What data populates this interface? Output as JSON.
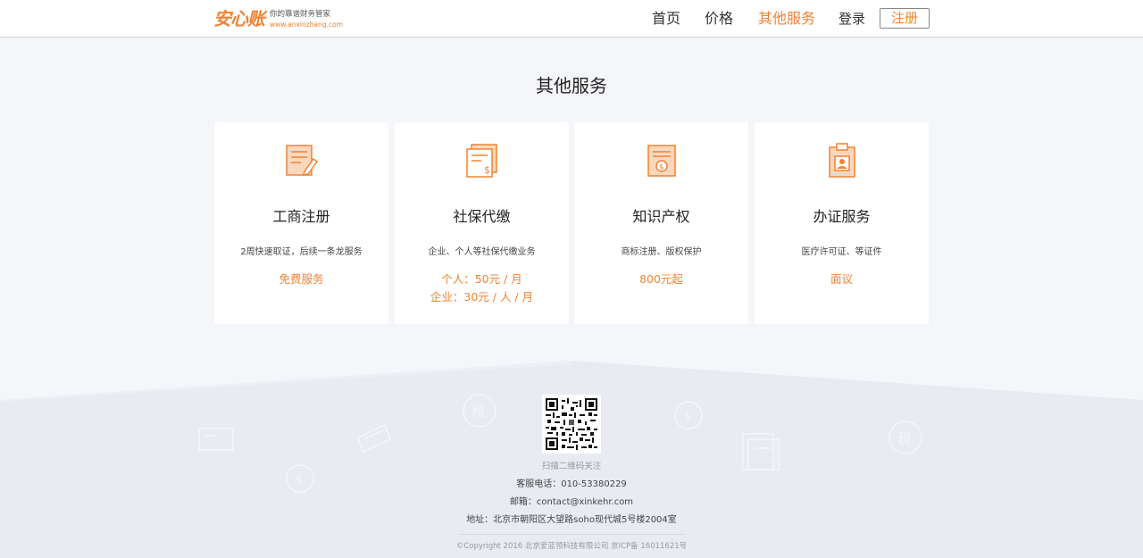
{
  "header": {
    "logo_main": "安心账",
    "logo_slogan": "你的靠谱财务管家",
    "logo_url": "www.anxinzhang.com",
    "nav": [
      {
        "label": "首页",
        "active": false
      },
      {
        "label": "价格",
        "active": false
      },
      {
        "label": "其他服务",
        "active": true
      }
    ],
    "login": "登录",
    "register": "注册"
  },
  "main": {
    "title": "其他服务",
    "cards": [
      {
        "icon": "document-edit-icon",
        "title": "工商注册",
        "desc": "2周快速取证，后续一条龙服务",
        "price": [
          "免费服务"
        ]
      },
      {
        "icon": "document-money-icon",
        "title": "社保代缴",
        "desc": "企业、个人等社保代缴业务",
        "price": [
          "个人：50元 / 月",
          "企业：30元 / 人 / 月"
        ]
      },
      {
        "icon": "certificate-coin-icon",
        "title": "知识产权",
        "desc": "商标注册、版权保护",
        "price": [
          "800元起"
        ]
      },
      {
        "icon": "clipboard-person-icon",
        "title": "办证服务",
        "desc": "医疗许可证、等证件",
        "price": [
          "面议"
        ]
      }
    ]
  },
  "footer": {
    "qr_label": "扫描二维码关注",
    "phone": "客服电话：010-53380229",
    "email": "邮箱：contact@xinkehr.com",
    "address": "地址：北京市朝阳区大望路soho现代城5号楼2004室",
    "copyright": "©Copyright 2016 北京爱蓝领科技有限公司 京ICP备 16011621号",
    "deco_tax_label": "税"
  },
  "colors": {
    "accent": "#f08335",
    "page_bg": "#f5f6f9",
    "footer_bg": "#e8ebf2"
  }
}
